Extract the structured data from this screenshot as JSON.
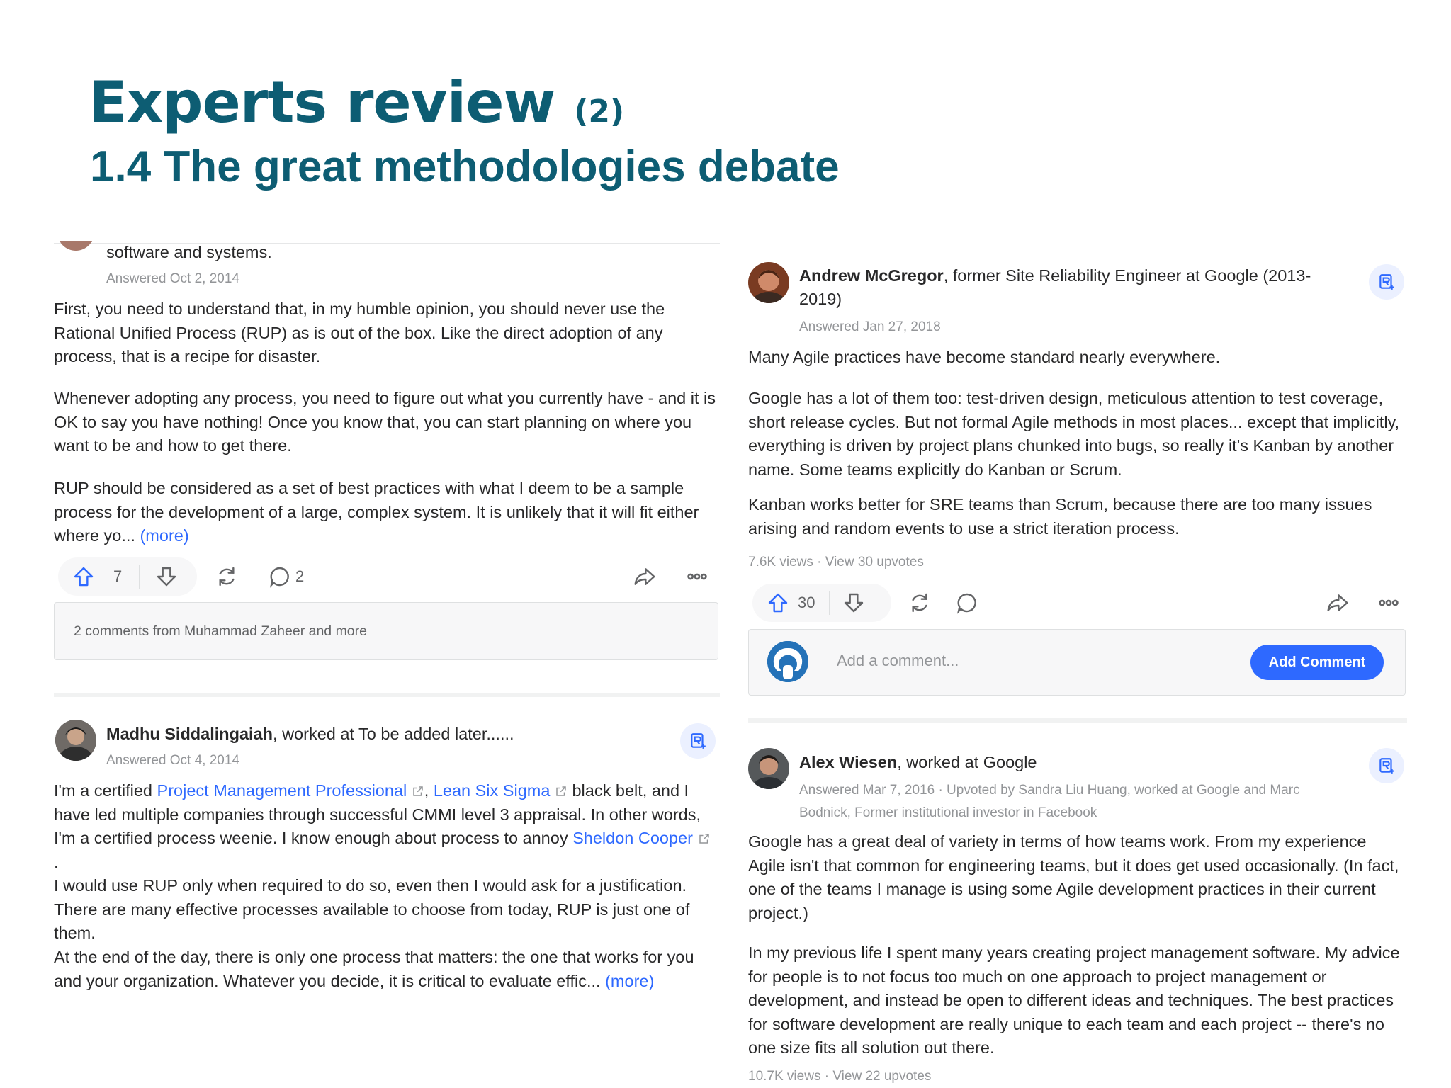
{
  "slide": {
    "title": "Experts review",
    "title_suffix": "(2)",
    "subtitle": "1.4 The great methodologies debate"
  },
  "left": {
    "answer1": {
      "cred_tail": "software and systems.",
      "date": "Answered Oct 2, 2014",
      "p1": "First, you need to understand that, in my humble opinion, you should never use the Rational Unified Process (RUP) as is out of the box. Like the direct adoption of any process, that is a recipe for disaster.",
      "p2": "Whenever adopting any process, you need to figure out what you currently have - and it is OK to say you have nothing! Once you know that, you can start planning on where you want to be and how to get there.",
      "p3": "RUP should be considered as a set of best practices with what I deem to be a sample process for the development of a large, complex system. It is unlikely that it will fit either where yo...",
      "more": "(more)",
      "upvotes": "7",
      "comments": "2",
      "comments_summary": "2 comments from Muhammad Zaheer and more"
    },
    "answer2": {
      "author": "Madhu Siddalingaiah",
      "cred": ", worked at To be added later......",
      "date": "Answered Oct 4, 2014",
      "t1": "I'm a certified ",
      "link1": "Project Management Professional",
      "t2": ", ",
      "link2": "Lean Six Sigma",
      "t3": " black belt, and I have led multiple companies through successful CMMI level 3 appraisal. In other words, I'm a certified process weenie. I know enough about process to annoy ",
      "link3": "Sheldon Cooper",
      "t4": ".",
      "p2": "I would use RUP only when required to do so, even then I would ask for a justification. There are many effective processes available to choose from today, RUP is just one of them.",
      "p3": "At the end of the day, there is only one process that matters: the one that works for you and your organization. Whatever you decide, it is critical to evaluate effic...",
      "more": "(more)"
    }
  },
  "right": {
    "answer1": {
      "author": "Andrew McGregor",
      "cred": ", former Site Reliability Engineer at Google (2013-2019)",
      "date": "Answered Jan 27, 2018",
      "p1": "Many Agile practices have become standard nearly everywhere.",
      "p2": "Google has a lot of them too: test-driven design, meticulous attention to test coverage, short release cycles. But not formal Agile methods in most places... except that implicitly, everything is driven by project plans chunked into bugs, so really it's Kanban by another name. Some teams explicitly do Kanban or Scrum.",
      "p3": "Kanban works better for SRE teams than Scrum, because there are too many issues arising and random events to use a strict iteration process.",
      "stats": "7.6K views · View 30 upvotes",
      "upvotes": "30",
      "comment_placeholder": "Add a comment...",
      "add_comment": "Add Comment"
    },
    "answer2": {
      "author": "Alex Wiesen",
      "cred": ", worked at Google",
      "date": "Answered Mar 7, 2016 · Upvoted by Sandra Liu Huang, worked at Google and Marc Bodnick, Former institutional investor in Facebook",
      "p1": "Google has a great deal of variety in terms of how teams work. From my experience Agile isn't that common for engineering teams, but it does get used occasionally. (In fact, one of the teams I manage is using some Agile development practices in their current project.)",
      "p2": "In my previous life I spent many years creating project management software. My advice for people is to not focus too much on one approach to project management or development, and instead be open to different ideas and techniques. The best practices for software development are really unique to each team and each project -- there's no one size fits all solution out there.",
      "stats": "10.7K views · View 22 upvotes"
    }
  },
  "icons": [
    "upvote-icon",
    "downvote-icon",
    "share-rotate-icon",
    "comment-icon",
    "share-icon",
    "more-icon",
    "follow-icon",
    "external-link-icon"
  ],
  "colors": {
    "title": "#0d5d73",
    "link": "#2e69ff",
    "text": "#282829",
    "meta": "#939598"
  }
}
